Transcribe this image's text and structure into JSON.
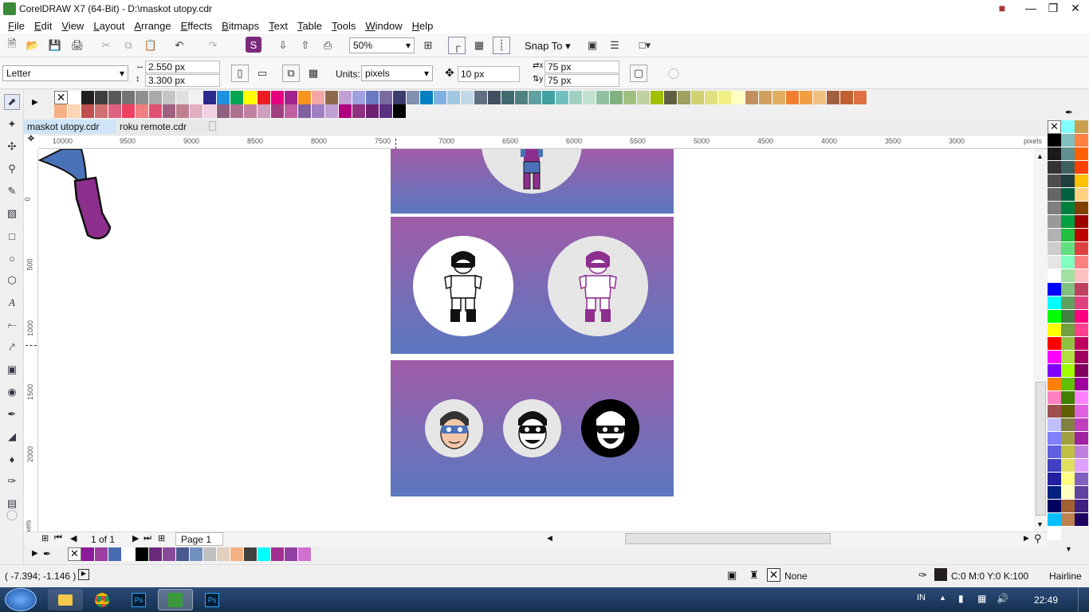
{
  "window": {
    "title": "CorelDRAW X7 (64-Bit) - D:\\maskot utopy.cdr"
  },
  "menu": [
    "File",
    "Edit",
    "View",
    "Layout",
    "Arrange",
    "Effects",
    "Bitmaps",
    "Text",
    "Table",
    "Tools",
    "Window",
    "Help"
  ],
  "standard_toolbar": {
    "zoom_level": "50%",
    "snap_to_label": "Snap To"
  },
  "property_bar": {
    "page_size": "Letter",
    "width": "2.550 px",
    "height": "3.300 px",
    "units_label": "Units:",
    "units_value": "pixels",
    "nudge": "10 px",
    "dup_x": "75 px",
    "dup_y": "75 px"
  },
  "tabs": [
    {
      "label": "maskot utopy.cdr",
      "active": true
    },
    {
      "label": "roku remote.cdr",
      "active": false
    }
  ],
  "rulers": {
    "h_labels": [
      "10000",
      "9500",
      "9000",
      "8500",
      "8000",
      "7500",
      "7000",
      "6500",
      "6000",
      "5500",
      "5000",
      "4500",
      "4000",
      "3500",
      "3000"
    ],
    "h_unit": "pixels",
    "v_labels": [
      "0",
      "500",
      "1000",
      "1500",
      "2000"
    ],
    "v_unit": "pixels"
  },
  "page_nav": {
    "page_count": "1 of 1",
    "page_tab": "Page 1"
  },
  "status": {
    "coords": "( -7.394; -1.146 )",
    "fill_label": "None",
    "outline_color": "C:0 M:0 Y:0 K:100",
    "outline_width": "Hairline"
  },
  "taskbar": {
    "language": "IN",
    "time": "22:49"
  },
  "colors": {
    "card_top": "#a05ca8",
    "card_bottom": "#5a78c0",
    "circle_light": "#e6e6e6",
    "mascot_purple": "#8e2f8e",
    "mascot_blue": "#4a72b8"
  },
  "top_palette_row1": [
    "#ffffff",
    "#231f20",
    "#3d3d3d",
    "#595959",
    "#747474",
    "#8f8f8f",
    "#aaaaaa",
    "#c4c4c4",
    "#e0e0e0",
    "#f0f0f0",
    "#2a2a8c",
    "#1e90e0",
    "#00a651",
    "#ffff00",
    "#ed1c24",
    "#e6007e",
    "#a3238e",
    "#f7941d",
    "#f4a6a6",
    "#8c6a4a",
    "#c0a0d0",
    "#a0a0e0",
    "#6a7ac0",
    "#7a6aa0",
    "#3c3c6c",
    "#8090b0",
    "#0080c0",
    "#80b0e0",
    "#a0c8e0",
    "#c0d8e8",
    "#607080",
    "#405060",
    "#406a70",
    "#508080",
    "#60a0a0",
    "#40a0a0",
    "#70c0c0",
    "#a0d0c0",
    "#c0e0d0",
    "#90c0a0",
    "#80b080",
    "#a0c080",
    "#c0d0a0",
    "#a0c000",
    "#606040",
    "#a0a060",
    "#d0d070",
    "#e0e080",
    "#f0f080",
    "#ffffc0",
    "#c09060",
    "#d0a060",
    "#e0b060",
    "#f08030",
    "#f0a040",
    "#f0c080",
    "#a06040",
    "#c06030",
    "#e07040"
  ],
  "top_palette_row2": [
    "#f4b183",
    "#fcd5b5",
    "#c05050",
    "#d07070",
    "#e06080",
    "#f04060",
    "#f08080",
    "#e05070",
    "#a06080",
    "#c08090",
    "#e0b0c0",
    "#f0d0e0",
    "#906080",
    "#b07090",
    "#c080a0",
    "#d0a0c0",
    "#a04080",
    "#c060a0",
    "#8060a0",
    "#a080c0",
    "#c0a0d0",
    "#b00080",
    "#903080",
    "#702070",
    "#5a3080",
    "#000000"
  ],
  "doc_palette": [
    "#8b1a9a",
    "#9b3ea0",
    "#4a6ab0",
    "#ffffff",
    "#000000",
    "#6a2a7a",
    "#8a4a9a",
    "#4a5a90",
    "#7090c0",
    "#c0c0c0",
    "#e0d0c0",
    "#f4b183",
    "#404040",
    "#00ffff",
    "#a03090",
    "#9040a0",
    "#d070d0"
  ],
  "right_palette_col1": [
    "#000000",
    "#1a1a1a",
    "#333333",
    "#4d4d4d",
    "#666666",
    "#808080",
    "#999999",
    "#b3b3b3",
    "#cccccc",
    "#e6e6e6",
    "#ffffff",
    "#0000ff",
    "#00ffff",
    "#00ff00",
    "#ffff00",
    "#ff0000",
    "#ff00ff",
    "#8000ff",
    "#ff8000",
    "#ff80c0",
    "#a05050",
    "#c0c0ff",
    "#8080ff",
    "#6060e0",
    "#4040c0",
    "#2020a0",
    "#002080",
    "#000060",
    "#00c0ff",
    "#ffffff"
  ],
  "right_palette_col2": [
    "#80ffff",
    "#80c0c0",
    "#609090",
    "#406060",
    "#204040",
    "#006040",
    "#008040",
    "#00a040",
    "#20c040",
    "#60e080",
    "#80ffc0",
    "#a0e0a0",
    "#80c080",
    "#60a060",
    "#408040",
    "#70a040",
    "#90c040",
    "#b0e040",
    "#a0ff00",
    "#60c000",
    "#408000",
    "#606000",
    "#808040",
    "#a0a040",
    "#c0c040",
    "#e0e060",
    "#ffff80",
    "#ffffc0",
    "#a06030",
    "#c08050"
  ],
  "right_palette_col3": [
    "#c8a050",
    "#ff8040",
    "#ff6000",
    "#ff4000",
    "#ffc000",
    "#ffd080",
    "#804000",
    "#a00000",
    "#c00000",
    "#e04040",
    "#ff8080",
    "#ffc0c0",
    "#c04060",
    "#e04080",
    "#ff0080",
    "#ff4090",
    "#c00060",
    "#a00060",
    "#800060",
    "#a000a0",
    "#ff80ff",
    "#e060e0",
    "#c040c0",
    "#a020a0",
    "#c080e0",
    "#e0a0ff",
    "#8060c0",
    "#6040a0",
    "#402080",
    "#200060"
  ]
}
